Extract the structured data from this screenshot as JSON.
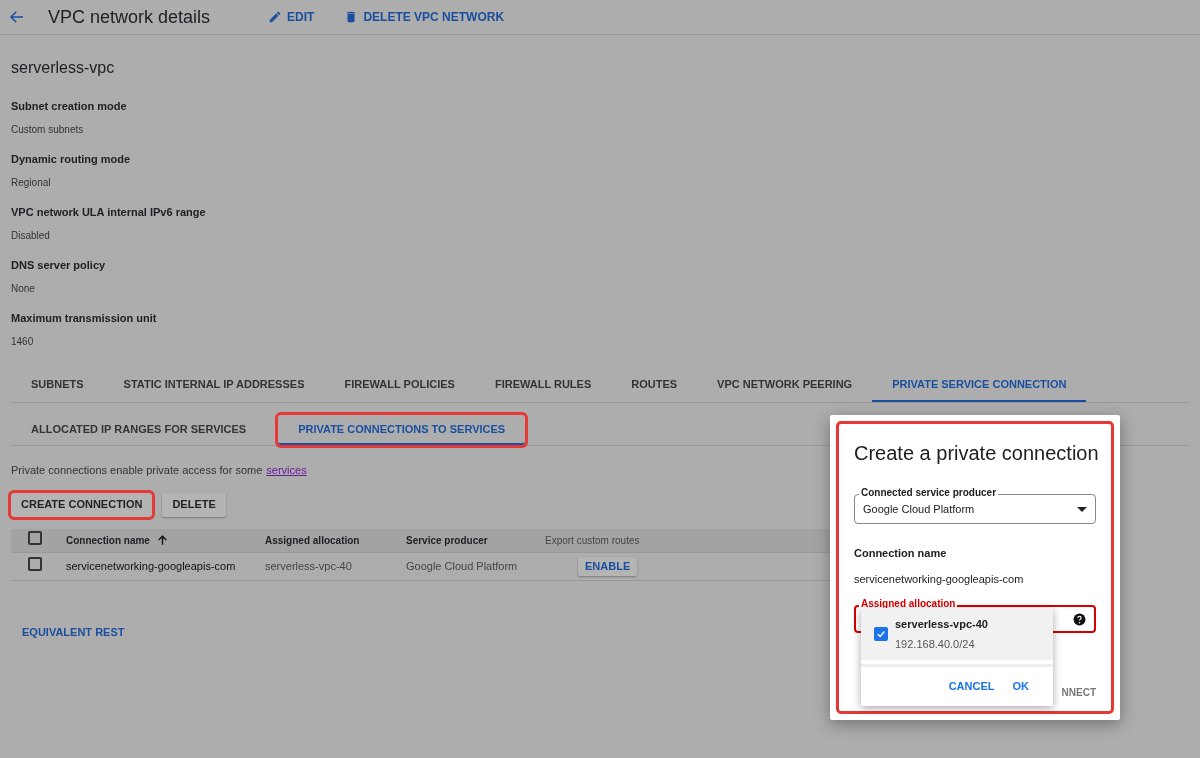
{
  "header": {
    "title": "VPC network details",
    "actions": [
      {
        "kind": "edit",
        "label": "EDIT"
      },
      {
        "kind": "delete",
        "label": "DELETE VPC NETWORK"
      }
    ]
  },
  "network_name": "serverless-vpc",
  "properties": [
    {
      "label": "Subnet creation mode",
      "value": "Custom subnets"
    },
    {
      "label": "Dynamic routing mode",
      "value": "Regional"
    },
    {
      "label": "VPC network ULA internal IPv6 range",
      "value": "Disabled"
    },
    {
      "label": "DNS server policy",
      "value": "None"
    },
    {
      "label": "Maximum transmission unit",
      "value": "1460"
    }
  ],
  "tabs": [
    {
      "label": "SUBNETS",
      "selected": false
    },
    {
      "label": "STATIC INTERNAL IP ADDRESSES",
      "selected": false
    },
    {
      "label": "FIREWALL POLICIES",
      "selected": false
    },
    {
      "label": "FIREWALL RULES",
      "selected": false
    },
    {
      "label": "ROUTES",
      "selected": false
    },
    {
      "label": "VPC NETWORK PEERING",
      "selected": false
    },
    {
      "label": "PRIVATE SERVICE CONNECTION",
      "selected": true
    }
  ],
  "subtabs": [
    {
      "label": "ALLOCATED IP RANGES FOR SERVICES",
      "selected": false,
      "highlighted": false
    },
    {
      "label": "PRIVATE CONNECTIONS TO SERVICES",
      "selected": true,
      "highlighted": true
    }
  ],
  "description": {
    "text": "Private connections enable private access for some",
    "link": "services"
  },
  "buttons": [
    {
      "label": "CREATE CONNECTION",
      "highlighted": true
    },
    {
      "label": "DELETE",
      "highlighted": false
    }
  ],
  "table": {
    "select_all_checked": false,
    "columns": [
      {
        "label": "Connection name",
        "sorted": true
      },
      {
        "label": "Assigned allocation",
        "sorted": false
      },
      {
        "label": "Service producer",
        "sorted": false
      },
      {
        "label": "Export custom routes",
        "sorted": false
      }
    ],
    "rows": [
      {
        "checked": false,
        "name": "servicenetworking-googleapis-com",
        "allocation": "serverless-vpc-40",
        "producer": "Google Cloud Platform",
        "action": "ENABLE"
      }
    ]
  },
  "equivalent_rest": "EQUIVALENT REST",
  "dialog": {
    "title": "Create a private connection",
    "highlighted": true,
    "producer_field": {
      "label": "Connected service producer",
      "value": "Google Cloud Platform"
    },
    "connection_name": {
      "label": "Connection name",
      "value": "servicenetworking-googleapis-com"
    },
    "allocation_field": {
      "label": "Assigned allocation",
      "error": true
    },
    "dropdown": {
      "options": [
        {
          "name": "serverless-vpc-40",
          "range": "192.168.40.0/24",
          "checked": true
        }
      ],
      "buttons": [
        "CANCEL",
        "OK"
      ]
    },
    "connect_button": "NNECT"
  }
}
